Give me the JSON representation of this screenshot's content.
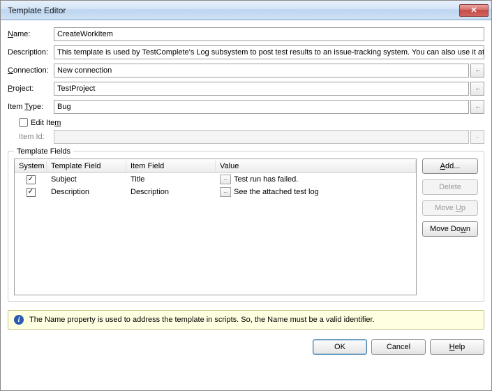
{
  "window": {
    "title": "Template Editor"
  },
  "labels": {
    "name": "Name:",
    "description": "Description:",
    "connection": "Connection:",
    "project": "Project:",
    "item_type": "Item Type:",
    "edit_item": "Edit Item",
    "item_id": "Item Id:",
    "template_fields": "Template Fields"
  },
  "values": {
    "name": "CreateWorkItem",
    "description": "This template is used by TestComplete's Log subsystem to post test results to an issue-tracking system. You can also use it at yo",
    "connection": "New connection",
    "project": "TestProject",
    "item_type": "Bug",
    "edit_item_checked": false,
    "item_id": ""
  },
  "table": {
    "headers": {
      "system": "System",
      "template_field": "Template Field",
      "item_field": "Item Field",
      "value": "Value"
    },
    "rows": [
      {
        "system_checked": true,
        "template_field": "Subject",
        "item_field": "Title",
        "value": "Test run has failed."
      },
      {
        "system_checked": true,
        "template_field": "Description",
        "item_field": "Description",
        "value": "See the attached test log"
      }
    ]
  },
  "buttons": {
    "add": "Add...",
    "delete": "Delete",
    "move_up": "Move Up",
    "move_down": "Move Down",
    "ok": "OK",
    "cancel": "Cancel",
    "help": "Help"
  },
  "info": {
    "text": "The Name property is used to address the template in scripts. So, the Name must be a valid identifier."
  }
}
